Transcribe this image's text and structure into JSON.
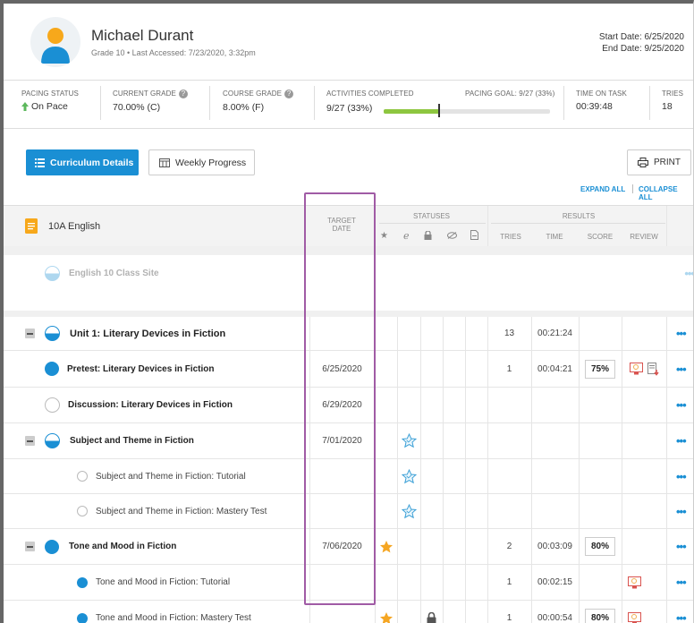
{
  "student": {
    "name": "Michael Durant",
    "subtitle": "Grade 10 • Last Accessed: 7/23/2020, 3:32pm",
    "start_date": "Start Date: 6/25/2020",
    "end_date": "End Date: 9/25/2020"
  },
  "stats": {
    "pacing_status_label": "PACING STATUS",
    "pacing_status_value": "On Pace",
    "current_grade_label": "CURRENT GRADE",
    "current_grade_value": "70.00% (C)",
    "course_grade_label": "COURSE GRADE",
    "course_grade_value": "8.00% (F)",
    "activities_label": "ACTIVITIES COMPLETED",
    "activities_value": "9/27 (33%)",
    "pacing_goal_label": "PACING GOAL: 9/27 (33%)",
    "time_on_task_label": "TIME ON TASK",
    "time_on_task_value": "00:39:48",
    "tries_label": "TRIES",
    "tries_value": "18",
    "progress_fraction": 0.33
  },
  "toolbar": {
    "curriculum_details": "Curriculum Details",
    "weekly_progress": "Weekly Progress",
    "print": "PRINT",
    "expand_all": "EXPAND ALL",
    "collapse_all": "COLLAPSE ALL"
  },
  "table": {
    "course_title": "10A English",
    "target_date_header_1": "TARGET",
    "target_date_header_2": "DATE",
    "statuses_header": "STATUSES",
    "results_header": "RESULTS",
    "col_tries": "TRIES",
    "col_time": "TIME",
    "col_score": "SCORE",
    "col_review": "REVIEW",
    "faded_row": "English 10 Class Site",
    "more_label": "•••",
    "rows": [
      {
        "title": "Unit 1: Literary Devices in Fiction",
        "date": "",
        "tries": "13",
        "time": "00:21:24",
        "score": ""
      },
      {
        "title": "Pretest: Literary Devices in Fiction",
        "date": "6/25/2020",
        "tries": "1",
        "time": "00:04:21",
        "score": "75%"
      },
      {
        "title": "Discussion: Literary Devices in Fiction",
        "date": "6/29/2020",
        "tries": "",
        "time": "",
        "score": ""
      },
      {
        "title": "Subject and Theme in Fiction",
        "date": "7/01/2020",
        "tries": "",
        "time": "",
        "score": ""
      },
      {
        "title": "Subject and Theme in Fiction: Tutorial",
        "date": "",
        "tries": "",
        "time": "",
        "score": ""
      },
      {
        "title": "Subject and Theme in Fiction: Mastery Test",
        "date": "",
        "tries": "",
        "time": "",
        "score": ""
      },
      {
        "title": "Tone and Mood in Fiction",
        "date": "7/06/2020",
        "tries": "2",
        "time": "00:03:09",
        "score": "80%"
      },
      {
        "title": "Tone and Mood in Fiction: Tutorial",
        "date": "",
        "tries": "1",
        "time": "00:02:15",
        "score": ""
      },
      {
        "title": "Tone and Mood in Fiction: Mastery Test",
        "date": "",
        "tries": "1",
        "time": "00:00:54",
        "score": "80%"
      }
    ]
  },
  "colors": {
    "accent": "#1a8fd4",
    "progress": "#8dc63f",
    "highlight": "#a05ba5",
    "star": "#f5a623"
  }
}
